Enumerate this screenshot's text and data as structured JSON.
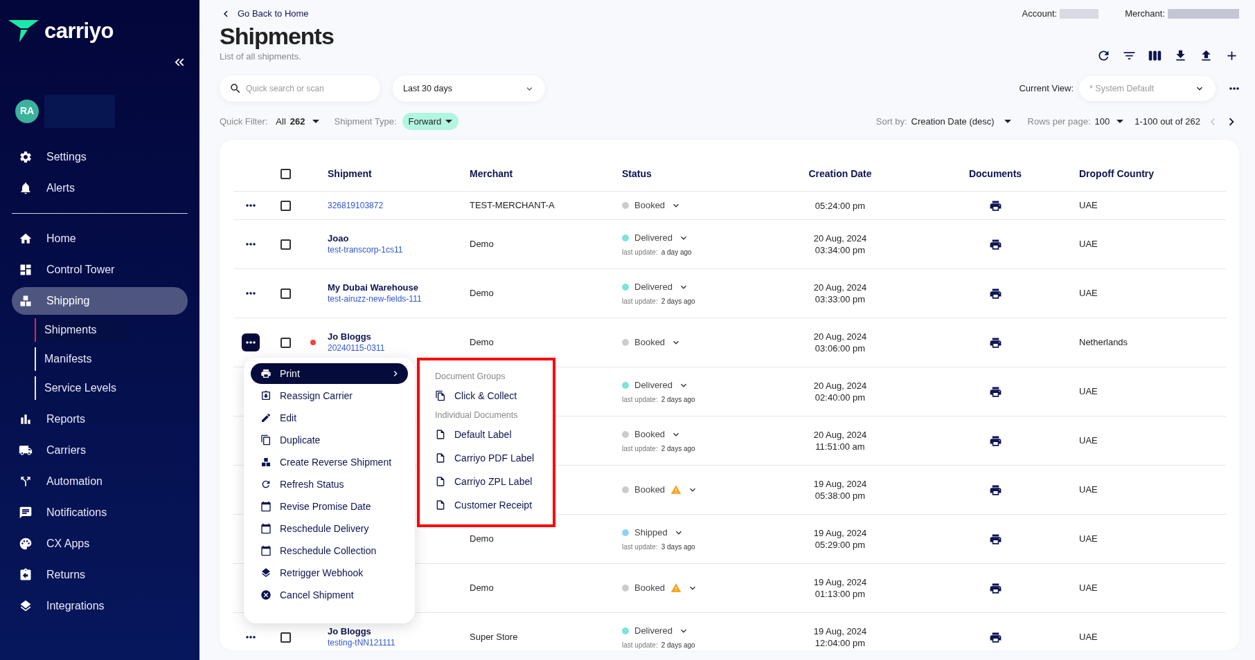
{
  "sidebar": {
    "brand": "carriyo",
    "avatar": "RA",
    "top_items": [
      {
        "label": "Settings",
        "selected": false
      },
      {
        "label": "Alerts",
        "selected": false
      }
    ],
    "nav_items": [
      {
        "label": "Home",
        "selected": false
      },
      {
        "label": "Control Tower",
        "selected": false
      },
      {
        "label": "Shipping",
        "selected": true,
        "children": [
          {
            "label": "Shipments",
            "selected": true
          },
          {
            "label": "Manifests",
            "selected": false
          },
          {
            "label": "Service Levels",
            "selected": false
          }
        ]
      },
      {
        "label": "Reports",
        "selected": false
      },
      {
        "label": "Carriers",
        "selected": false
      },
      {
        "label": "Automation",
        "selected": false
      },
      {
        "label": "Notifications",
        "selected": false
      },
      {
        "label": "CX Apps",
        "selected": false
      },
      {
        "label": "Returns",
        "selected": false
      },
      {
        "label": "Integrations",
        "selected": false
      }
    ]
  },
  "header": {
    "back_link": "Go Back to Home",
    "title": "Shipments",
    "subtitle": "List of all shipments.",
    "account_label": "Account:",
    "merchant_label": "Merchant:"
  },
  "search": {
    "placeholder": "Quick search or scan"
  },
  "date_range": {
    "value": "Last 30 days"
  },
  "current_view": {
    "label": "Current View:",
    "placeholder": "* System Default"
  },
  "quick_filter": {
    "label": "Quick Filter:",
    "value": "All",
    "count": "262"
  },
  "shipment_type": {
    "label": "Shipment Type:",
    "value": "Forward"
  },
  "sort": {
    "label": "Sort by:",
    "value": "Creation Date (desc)"
  },
  "rows_per_page": {
    "label": "Rows per page:",
    "value": "100"
  },
  "pagination": {
    "range": "1-100 out of 262",
    "prev_disabled": true,
    "next_disabled": false
  },
  "table": {
    "select_all_checked": false,
    "columns": [
      "Shipment",
      "Merchant",
      "Status",
      "Creation Date",
      "Documents",
      "Dropoff Country"
    ],
    "rows": [
      {
        "menu_open": false,
        "checked": false,
        "alert": false,
        "tracking": "326819103872",
        "merchant": "TEST-MERCHANT-A",
        "status": {
          "label": "Booked",
          "color": "#cccccc",
          "warning": false
        },
        "time": "05:24:00 pm",
        "country": "UAE"
      },
      {
        "menu_open": false,
        "checked": false,
        "alert": false,
        "name": "Joao",
        "tracking": "test-transcorp-1cs11",
        "merchant": "Demo",
        "status": {
          "label": "Delivered",
          "color": "#7ee3d8",
          "warning": false,
          "last_update_label": "last update:",
          "last_update": "a day ago"
        },
        "date": "20 Aug, 2024",
        "time": "03:34:00 pm",
        "country": "UAE"
      },
      {
        "menu_open": false,
        "checked": false,
        "alert": false,
        "name": "My Dubai Warehouse",
        "tracking": "test-airuzz-new-fields-111",
        "merchant": "Demo",
        "status": {
          "label": "Delivered",
          "color": "#7ee3d8",
          "warning": false,
          "last_update_label": "last update:",
          "last_update": "2 days ago"
        },
        "date": "20 Aug, 2024",
        "time": "03:33:00 pm",
        "country": "UAE"
      },
      {
        "menu_open": true,
        "checked": false,
        "alert": true,
        "name": "Jo Bloggs",
        "tracking": "20240115-0311",
        "merchant": "Demo",
        "status": {
          "label": "Booked",
          "color": "#cccccc",
          "warning": false
        },
        "date": "20 Aug, 2024",
        "time": "03:06:00 pm",
        "country": "Netherlands"
      },
      {
        "status": {
          "label": "Delivered",
          "color": "#7ee3d8",
          "warning": false,
          "last_update_label": "last update:",
          "last_update": "2 days ago"
        },
        "date": "20 Aug, 2024",
        "time": "02:40:00 pm",
        "country": "UAE"
      },
      {
        "status": {
          "label": "Booked",
          "color": "#cccccc",
          "warning": false,
          "last_update_label": "last update:",
          "last_update": "2 days ago"
        },
        "date": "20 Aug, 2024",
        "time": "11:51:00 am",
        "country": "UAE"
      },
      {
        "status": {
          "label": "Booked",
          "color": "#cccccc",
          "warning": true
        },
        "date": "19 Aug, 2024",
        "time": "05:38:00 pm",
        "country": "UAE"
      },
      {
        "merchant": "Demo",
        "status": {
          "label": "Shipped",
          "color": "#8dd3f7",
          "warning": false,
          "last_update_label": "last update:",
          "last_update": "3 days ago"
        },
        "date": "19 Aug, 2024",
        "time": "05:29:00 pm",
        "country": "UAE"
      },
      {
        "merchant": "Demo",
        "status": {
          "label": "Booked",
          "color": "#cccccc",
          "warning": true
        },
        "date": "19 Aug, 2024",
        "time": "01:13:00 pm",
        "country": "UAE"
      },
      {
        "menu_open": false,
        "checked": false,
        "alert": false,
        "name": "Jo Bloggs",
        "tracking": "testing-tNN121111",
        "merchant": "Super Store",
        "status": {
          "label": "Delivered",
          "color": "#7ee3d8",
          "warning": false,
          "last_update_label": "last update:",
          "last_update": "2 days ago"
        },
        "date": "19 Aug, 2024",
        "time": "12:04:00 pm",
        "country": "UAE"
      }
    ]
  },
  "row_menu": {
    "items": [
      {
        "label": "Print",
        "selected": true,
        "expanded": true
      },
      {
        "label": "Reassign Carrier",
        "selected": false,
        "expanded": false
      },
      {
        "label": "Edit",
        "selected": false,
        "expanded": false
      },
      {
        "label": "Duplicate",
        "selected": false,
        "expanded": false
      },
      {
        "label": "Create Reverse Shipment",
        "selected": false,
        "expanded": false
      },
      {
        "label": "Refresh Status",
        "selected": false,
        "expanded": false
      },
      {
        "label": "Revise Promise Date",
        "selected": false,
        "expanded": false
      },
      {
        "label": "Reschedule Delivery",
        "selected": false,
        "expanded": false
      },
      {
        "label": "Reschedule Collection",
        "selected": false,
        "expanded": false
      },
      {
        "label": "Retrigger Webhook",
        "selected": false,
        "expanded": false
      },
      {
        "label": "Cancel Shipment",
        "selected": false,
        "expanded": false
      }
    ]
  },
  "print_submenu": {
    "sections": [
      {
        "kind": "group",
        "title": "Document Groups",
        "items": [
          "Click & Collect"
        ]
      },
      {
        "kind": "document",
        "title": "Individual Documents",
        "items": [
          "Default Label",
          "Carriyo PDF Label",
          "Carriyo ZPL Label",
          "Customer Receipt"
        ]
      }
    ]
  }
}
